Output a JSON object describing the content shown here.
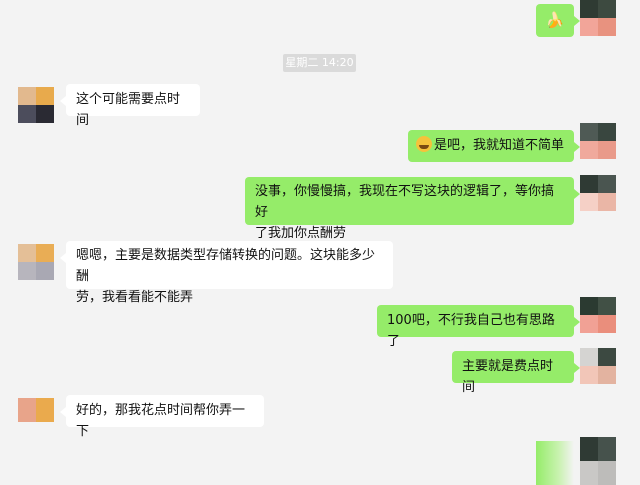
{
  "timestamp": "星期二 14:20",
  "messages": [
    {
      "id": "m1",
      "side": "me",
      "text": "",
      "sticker": "banana-sticker",
      "sticker_glyph": "🍌"
    },
    {
      "id": "m2",
      "side": "other",
      "text": "这个可能需要点时间"
    },
    {
      "id": "m3",
      "side": "me",
      "emoji": "grin-emoji",
      "text": "是吧，我就知道不简单"
    },
    {
      "id": "m4",
      "side": "me",
      "line1": "没事，你慢慢搞，我现在不写这块的逻辑了，等你搞好",
      "line2": "了我加你点酬劳"
    },
    {
      "id": "m5",
      "side": "other",
      "line1": "嗯嗯，主要是数据类型存储转换的问题。这块能多少酬",
      "line2": "劳，我看看能不能弄"
    },
    {
      "id": "m6",
      "side": "me",
      "text": "100吧，不行我自己也有思路了"
    },
    {
      "id": "m7",
      "side": "me",
      "text": "主要就是费点时间"
    },
    {
      "id": "m8",
      "side": "other",
      "text": "好的，那我花点时间帮你弄一下"
    }
  ],
  "colors": {
    "me_bubble": "#95ec69",
    "other_bubble": "#ffffff",
    "background": "#f3f3f3",
    "timestamp_bg": "#dadada"
  }
}
